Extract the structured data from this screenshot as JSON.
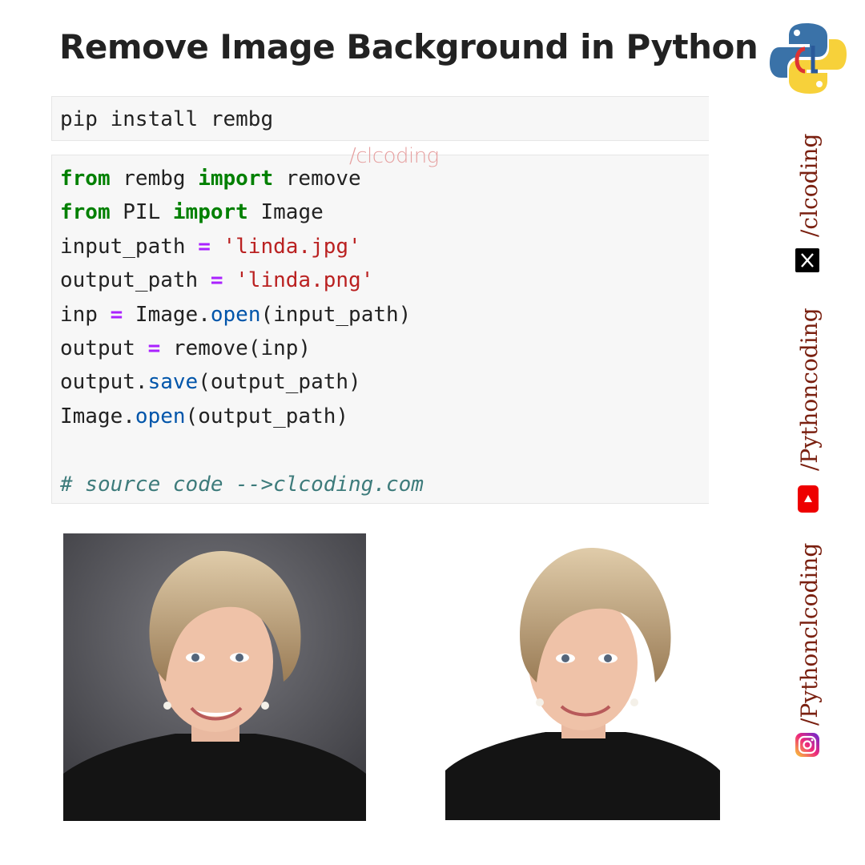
{
  "header": {
    "title": "Remove Image Background in Python"
  },
  "install_cell": {
    "code": "pip install rembg"
  },
  "code_cell": {
    "l1": {
      "kw1": "from",
      "mod": " rembg ",
      "kw2": "import",
      "name": " remove"
    },
    "l2": {
      "kw1": "from",
      "mod": " PIL ",
      "kw2": "import",
      "name": " Image"
    },
    "l3": {
      "var": "input_path ",
      "op": "=",
      "sp": " ",
      "str": "'linda.jpg'"
    },
    "l4": {
      "var": "output_path ",
      "op": "=",
      "sp": " ",
      "str": "'linda.png'"
    },
    "l5": {
      "var": "inp ",
      "op": "=",
      "pre": " Image.",
      "fn": "open",
      "args": "(input_path)"
    },
    "l6": {
      "var": "output ",
      "op": "=",
      "rest": " remove(inp)"
    },
    "l7": {
      "pre": "output.",
      "fn": "save",
      "args": "(output_path)"
    },
    "l8": {
      "pre": "Image.",
      "fn": "open",
      "args": "(output_path)"
    },
    "comment": "# source code -->clcoding.com"
  },
  "watermark": "/clcoding",
  "social": [
    {
      "handle": "/clcoding",
      "icon": "x-icon"
    },
    {
      "handle": "/Pythoncoding",
      "icon": "youtube-icon"
    },
    {
      "handle": "/Pythonclcoding",
      "icon": "instagram-icon"
    }
  ],
  "images": {
    "before": {
      "subject": "portrait-original",
      "background": "gray"
    },
    "after": {
      "subject": "portrait-background-removed",
      "background": "white"
    }
  },
  "colors": {
    "keyword": "#008000",
    "operator": "#aa22ff",
    "string": "#ba2121",
    "function": "#0055aa",
    "comment": "#3d7b7b",
    "handle_text": "#7a2010"
  }
}
